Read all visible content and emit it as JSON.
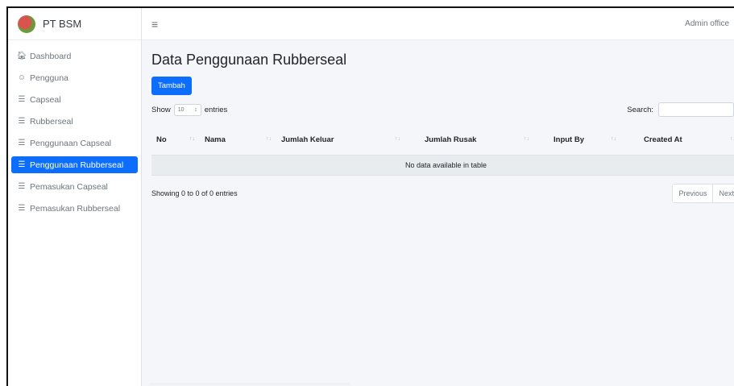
{
  "brand": {
    "name": "PT BSM"
  },
  "sidebar": {
    "items": [
      {
        "label": "Dashboard",
        "icon": "home-icon",
        "active": false
      },
      {
        "label": "Pengguna",
        "icon": "users-icon",
        "active": false
      },
      {
        "label": "Capseal",
        "icon": "list-icon",
        "active": false
      },
      {
        "label": "Rubberseal",
        "icon": "list-icon",
        "active": false
      },
      {
        "label": "Penggunaan Capseal",
        "icon": "list-icon",
        "active": false
      },
      {
        "label": "Penggunaan Rubberseal",
        "icon": "list-icon",
        "active": true
      },
      {
        "label": "Pemasukan Capseal",
        "icon": "list-icon",
        "active": false
      },
      {
        "label": "Pemasukan Rubberseal",
        "icon": "list-icon",
        "active": false
      }
    ]
  },
  "header": {
    "user": "Admin office"
  },
  "main": {
    "title": "Data Penggunaan Rubberseal",
    "add_button": "Tambah",
    "length": {
      "prefix": "Show",
      "value": "10",
      "suffix": "entries"
    },
    "search_label": "Search:",
    "search_value": "",
    "columns": [
      "No",
      "Nama",
      "Jumlah Keluar",
      "Jumlah Rusak",
      "Input By",
      "Created At"
    ],
    "empty_message": "No data available in table",
    "info": "Showing 0 to 0 of 0 entries",
    "pager": {
      "previous": "Previous",
      "next": "Next"
    }
  },
  "colors": {
    "accent": "#0d6efd",
    "background": "#f4f6f9"
  }
}
